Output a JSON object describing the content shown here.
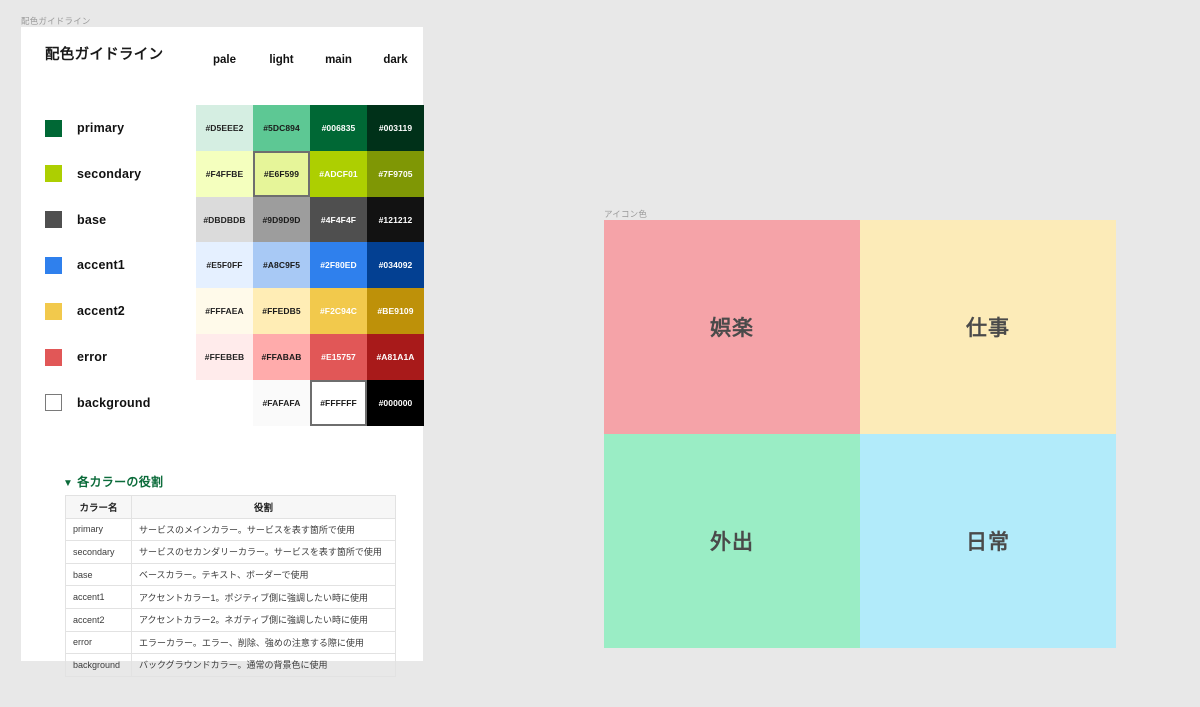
{
  "frames": {
    "guideline_label": "配色ガイドライン",
    "icon_label": "アイコン色"
  },
  "guideline": {
    "title": "配色ガイドライン",
    "columns": [
      "pale",
      "light",
      "main",
      "dark"
    ],
    "rows": [
      {
        "name": "primary",
        "chip": "#006835",
        "cells": [
          {
            "hex": "#D5EEE2",
            "text": "#D5EEE2",
            "fg": "#222222",
            "selected": false
          },
          {
            "hex": "#5DC894",
            "text": "#5DC894",
            "fg": "#1A1A1A",
            "selected": false
          },
          {
            "hex": "#006835",
            "text": "#006835",
            "fg": "#FFFFFF",
            "selected": false
          },
          {
            "hex": "#003119",
            "text": "#003119",
            "fg": "#FFFFFF",
            "selected": false
          }
        ]
      },
      {
        "name": "secondary",
        "chip": "#ADCF01",
        "cells": [
          {
            "hex": "#F4FFBE",
            "text": "#F4FFBE",
            "fg": "#222222",
            "selected": false
          },
          {
            "hex": "#E6F599",
            "text": "#E6F599",
            "fg": "#1A1A1A",
            "selected": true
          },
          {
            "hex": "#ADCF01",
            "text": "#ADCF01",
            "fg": "#FFFFFF",
            "selected": false
          },
          {
            "hex": "#7F9705",
            "text": "#7F9705",
            "fg": "#FFFFFF",
            "selected": false
          }
        ]
      },
      {
        "name": "base",
        "chip": "#4F4F4F",
        "cells": [
          {
            "hex": "#DBDBDB",
            "text": "#DBDBDB",
            "fg": "#222222",
            "selected": false
          },
          {
            "hex": "#9D9D9D",
            "text": "#9D9D9D",
            "fg": "#1A1A1A",
            "selected": false
          },
          {
            "hex": "#4F4F4F",
            "text": "#4F4F4F",
            "fg": "#FFFFFF",
            "selected": false
          },
          {
            "hex": "#121212",
            "text": "#121212",
            "fg": "#FFFFFF",
            "selected": false
          }
        ]
      },
      {
        "name": "accent1",
        "chip": "#2F80ED",
        "cells": [
          {
            "hex": "#E5F0FF",
            "text": "#E5F0FF",
            "fg": "#222222",
            "selected": false
          },
          {
            "hex": "#A8C9F5",
            "text": "#A8C9F5",
            "fg": "#1A1A1A",
            "selected": false
          },
          {
            "hex": "#2F80ED",
            "text": "#2F80ED",
            "fg": "#FFFFFF",
            "selected": false
          },
          {
            "hex": "#034092",
            "text": "#034092",
            "fg": "#FFFFFF",
            "selected": false
          }
        ]
      },
      {
        "name": "accent2",
        "chip": "#F2C94C",
        "cells": [
          {
            "hex": "#FFFAEA",
            "text": "#FFFAEA",
            "fg": "#222222",
            "selected": false
          },
          {
            "hex": "#FFEDB5",
            "text": "#FFEDB5",
            "fg": "#1A1A1A",
            "selected": false
          },
          {
            "hex": "#F2C94C",
            "text": "#F2C94C",
            "fg": "#FFFFFF",
            "selected": false
          },
          {
            "hex": "#BE9109",
            "text": "#BE9109",
            "fg": "#FFFFFF",
            "selected": false
          }
        ]
      },
      {
        "name": "error",
        "chip": "#E15757",
        "cells": [
          {
            "hex": "#FFEBEB",
            "text": "#FFEBEB",
            "fg": "#222222",
            "selected": false
          },
          {
            "hex": "#FFABAB",
            "text": "#FFABAB",
            "fg": "#1A1A1A",
            "selected": false
          },
          {
            "hex": "#E15757",
            "text": "#E15757",
            "fg": "#FFFFFF",
            "selected": false
          },
          {
            "hex": "#A81A1A",
            "text": "#A81A1A",
            "fg": "#FFFFFF",
            "selected": false
          }
        ]
      },
      {
        "name": "background",
        "chip": "#FFFFFF",
        "chip_outlined": true,
        "cells": [
          {
            "hex": "",
            "text": "",
            "fg": "",
            "selected": false,
            "empty": true
          },
          {
            "hex": "#FAFAFA",
            "text": "#FAFAFA",
            "fg": "#222222",
            "selected": false
          },
          {
            "hex": "#FFFFFF",
            "text": "#FFFFFF",
            "fg": "#1A1A1A",
            "selected": true
          },
          {
            "hex": "#000000",
            "text": "#000000",
            "fg": "#FFFFFF",
            "selected": false
          }
        ]
      }
    ]
  },
  "roles": {
    "heading": "各カラーの役割",
    "triangle": "▼",
    "headers": [
      "カラー名",
      "役割"
    ],
    "rows": [
      [
        "primary",
        "サービスのメインカラー。サービスを表す箇所で使用"
      ],
      [
        "secondary",
        "サービスのセカンダリーカラー。サービスを表す箇所で使用"
      ],
      [
        "base",
        "ベースカラー。テキスト、ボーダーで使用"
      ],
      [
        "accent1",
        "アクセントカラー1。ポジティブ側に強調したい時に使用"
      ],
      [
        "accent2",
        "アクセントカラー2。ネガティブ側に強調したい時に使用"
      ],
      [
        "error",
        "エラーカラー。エラー、削除、強めの注意する際に使用"
      ],
      [
        "background",
        "バックグラウンドカラー。通常の背景色に使用"
      ]
    ]
  },
  "icon_colors": {
    "label": "アイコン色",
    "quadrants": [
      {
        "label": "娯楽",
        "color": "#F5A3A8"
      },
      {
        "label": "仕事",
        "color": "#FCEBB8"
      },
      {
        "label": "外出",
        "color": "#9AEDC5"
      },
      {
        "label": "日常",
        "color": "#B2EBFA"
      }
    ]
  }
}
